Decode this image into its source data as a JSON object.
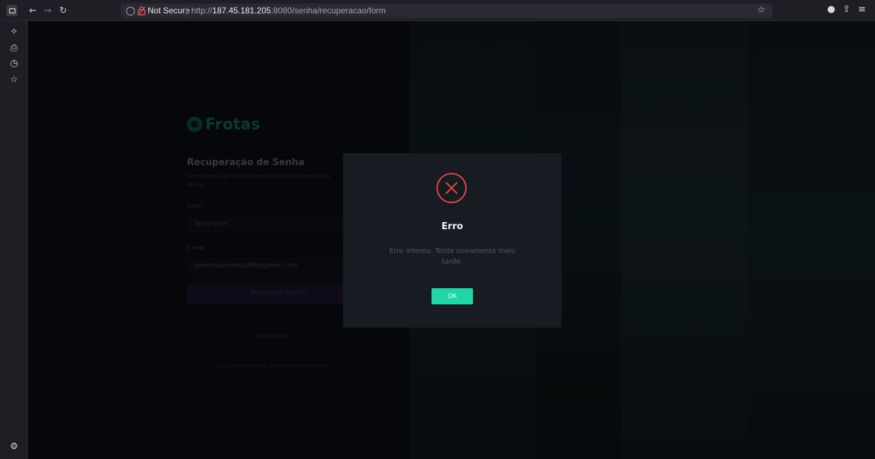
{
  "browser": {
    "security_label": "Not Secure",
    "url_prefix": "http://",
    "url_host": "187.45.181.205",
    "url_rest": ":8080/senha/recuperacao/form",
    "icons": [
      "sidebar-toggle-icon",
      "back-icon",
      "forward-icon",
      "reload-icon",
      "shield-icon",
      "lock-icon",
      "bookmark-star-icon",
      "account-icon",
      "extensions-icon",
      "menu-icon"
    ]
  },
  "sidebar": {
    "icons": [
      "ai-sparkle-icon",
      "synced-tabs-icon",
      "history-icon",
      "bookmarks-icon",
      "settings-icon"
    ]
  },
  "page": {
    "logo_text": "Frotas",
    "title": "Recuperação de Senha",
    "subtitle": "Informe seu Login e e-mail para solicitar a recuperação de senha.",
    "login_label": "Login",
    "login_value": "Tester.Jhon",
    "email_label": "E-mail",
    "email_value": "jonathassantos1899@gmail.com",
    "recover_button": "Recuperar Senha",
    "back_link": "Voltar ao login",
    "copyright": "© 2025 Sistema GFrotas. Todos os direitos reservados."
  },
  "modal": {
    "title": "Erro",
    "message": "Erro interno. Tente novamente mais tarde.",
    "ok_label": "OK",
    "icon": "error-x-circle-icon",
    "accent_color": "#e2473f",
    "button_color": "#1fd6a7"
  }
}
